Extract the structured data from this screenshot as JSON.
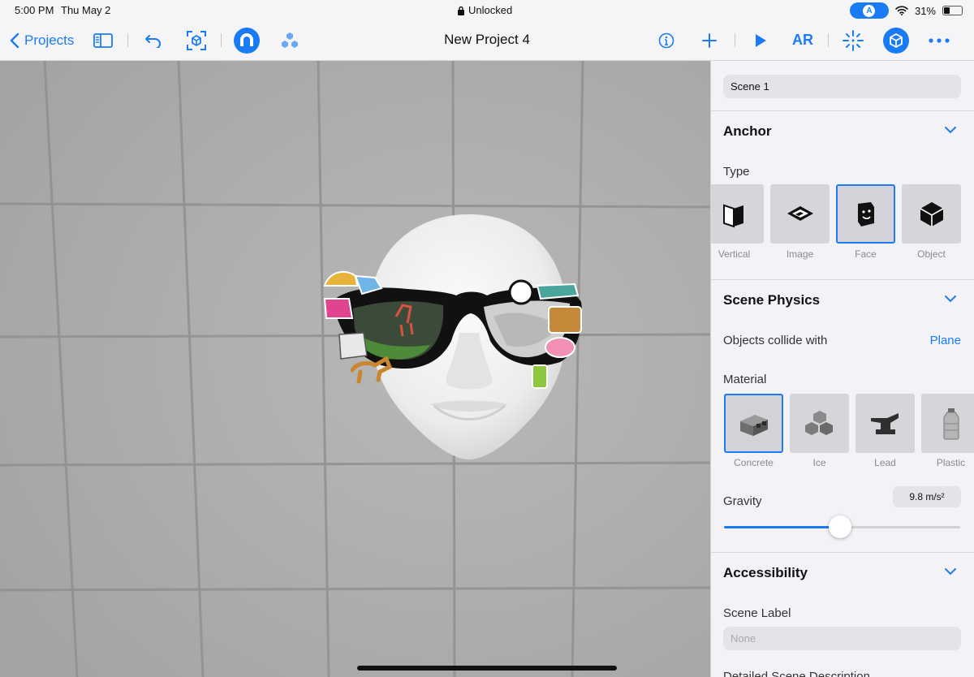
{
  "status_bar": {
    "time": "5:00 PM",
    "date": "Thu May 2",
    "lock_label": "Unlocked",
    "battery": "31%"
  },
  "toolbar": {
    "back_label": "Projects",
    "title": "New Project 4",
    "ar_label": "AR"
  },
  "inspector": {
    "scene_name": "Scene 1",
    "anchor": {
      "title": "Anchor",
      "type_label": "Type",
      "types": [
        {
          "label": "Vertical",
          "icon": "vertical-plane-icon",
          "selected": false
        },
        {
          "label": "Image",
          "icon": "image-anchor-icon",
          "selected": false
        },
        {
          "label": "Face",
          "icon": "face-anchor-icon",
          "selected": true
        },
        {
          "label": "Object",
          "icon": "object-anchor-icon",
          "selected": false
        }
      ]
    },
    "physics": {
      "title": "Scene Physics",
      "collide_label": "Objects collide with",
      "collide_value": "Plane",
      "material_label": "Material",
      "materials": [
        {
          "label": "Concrete",
          "icon": "concrete-icon",
          "selected": true
        },
        {
          "label": "Ice",
          "icon": "ice-icon",
          "selected": false
        },
        {
          "label": "Lead",
          "icon": "lead-icon",
          "selected": false
        },
        {
          "label": "Plastic",
          "icon": "plastic-icon",
          "selected": false
        }
      ],
      "gravity_label": "Gravity",
      "gravity_value": "9.8 m/s²",
      "gravity_slider_fraction": 0.49
    },
    "accessibility": {
      "title": "Accessibility",
      "scene_label_title": "Scene Label",
      "scene_label_placeholder": "None",
      "detailed_description_title": "Detailed Scene Description"
    }
  },
  "colors": {
    "accent": "#1a7cf5",
    "viewport_background": "#adadad"
  }
}
